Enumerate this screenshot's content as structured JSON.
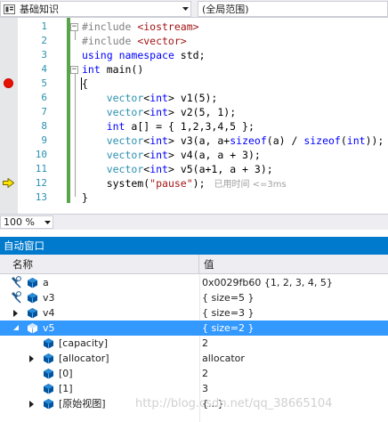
{
  "navbar": {
    "project": "基础知识",
    "scope": "(全局范围)"
  },
  "editor": {
    "line_numbers": [
      "1",
      "2",
      "3",
      "4",
      "5",
      "6",
      "7",
      "8",
      "9",
      "10",
      "11",
      "12",
      "13"
    ],
    "breakpoint_line": 5,
    "current_line": 12,
    "perf_tip": "已用时间 <=3ms",
    "code_lines": [
      [
        {
          "t": "#include ",
          "c": "pp"
        },
        {
          "t": "<iostream>",
          "c": "str"
        }
      ],
      [
        {
          "t": "#include ",
          "c": "pp"
        },
        {
          "t": "<vector>",
          "c": "str"
        }
      ],
      [
        {
          "t": "using",
          "c": "kw"
        },
        {
          "t": " "
        },
        {
          "t": "namespace",
          "c": "kw"
        },
        {
          "t": " std;"
        }
      ],
      [
        {
          "t": "int",
          "c": "kw"
        },
        {
          "t": " main()"
        }
      ],
      [
        {
          "t": "{"
        }
      ],
      [
        {
          "t": "    "
        },
        {
          "t": "vector",
          "c": "ty"
        },
        {
          "t": "<"
        },
        {
          "t": "int",
          "c": "kw"
        },
        {
          "t": "> v1(5);"
        }
      ],
      [
        {
          "t": "    "
        },
        {
          "t": "vector",
          "c": "ty"
        },
        {
          "t": "<"
        },
        {
          "t": "int",
          "c": "kw"
        },
        {
          "t": "> v2(5, 1);"
        }
      ],
      [
        {
          "t": "    "
        },
        {
          "t": "int",
          "c": "kw"
        },
        {
          "t": " a[] = { 1,2,3,4,5 };"
        }
      ],
      [
        {
          "t": "    "
        },
        {
          "t": "vector",
          "c": "ty"
        },
        {
          "t": "<"
        },
        {
          "t": "int",
          "c": "kw"
        },
        {
          "t": "> v3(a, a+"
        },
        {
          "t": "sizeof",
          "c": "kw"
        },
        {
          "t": "(a) / "
        },
        {
          "t": "sizeof",
          "c": "kw"
        },
        {
          "t": "("
        },
        {
          "t": "int",
          "c": "kw"
        },
        {
          "t": "));"
        }
      ],
      [
        {
          "t": "    "
        },
        {
          "t": "vector",
          "c": "ty"
        },
        {
          "t": "<"
        },
        {
          "t": "int",
          "c": "kw"
        },
        {
          "t": "> v4(a, a + 3);"
        }
      ],
      [
        {
          "t": "    "
        },
        {
          "t": "vector",
          "c": "ty"
        },
        {
          "t": "<"
        },
        {
          "t": "int",
          "c": "kw"
        },
        {
          "t": "> v5(a+1, a + 3);"
        }
      ],
      [
        {
          "t": "    system("
        },
        {
          "t": "\"pause\"",
          "c": "str"
        },
        {
          "t": ");"
        }
      ],
      [
        {
          "t": "}"
        }
      ]
    ]
  },
  "zoom": {
    "level": "100 %"
  },
  "autos": {
    "title": "自动窗口",
    "col_name": "名称",
    "col_value": "值",
    "rows": [
      {
        "name": "a",
        "value": "0x0029fb60 {1, 2, 3, 4, 5}",
        "level": 0,
        "expander": "none",
        "pin": true,
        "selected": false
      },
      {
        "name": "v3",
        "value": "{ size=5 }",
        "level": 0,
        "expander": "none",
        "pin": true,
        "selected": false
      },
      {
        "name": "v4",
        "value": "{ size=3 }",
        "level": 0,
        "expander": "collapsed",
        "pin": false,
        "selected": false
      },
      {
        "name": "v5",
        "value": "{ size=2 }",
        "level": 0,
        "expander": "expanded",
        "pin": false,
        "selected": true
      },
      {
        "name": "[capacity]",
        "value": "2",
        "level": 1,
        "expander": "none",
        "pin": false,
        "selected": false
      },
      {
        "name": "[allocator]",
        "value": "allocator",
        "level": 1,
        "expander": "collapsed",
        "pin": false,
        "selected": false
      },
      {
        "name": "[0]",
        "value": "2",
        "level": 1,
        "expander": "none",
        "pin": false,
        "selected": false
      },
      {
        "name": "[1]",
        "value": "3",
        "level": 1,
        "expander": "none",
        "pin": false,
        "selected": false
      },
      {
        "name": "[原始视图]",
        "value": "{...}",
        "level": 1,
        "expander": "collapsed",
        "pin": false,
        "selected": false
      }
    ]
  },
  "watermark": "http://blog.csdn.net/qq_38665104",
  "colors": {
    "accent": "#007acc",
    "selection": "#3399ff",
    "breakpoint": "#e51400",
    "change_bar": "#57a64a"
  },
  "icons": {
    "breakpoint": "breakpoint-icon",
    "instruction_pointer": "instruction-pointer-icon",
    "variable": "variable-icon",
    "pin": "pin-icon"
  }
}
